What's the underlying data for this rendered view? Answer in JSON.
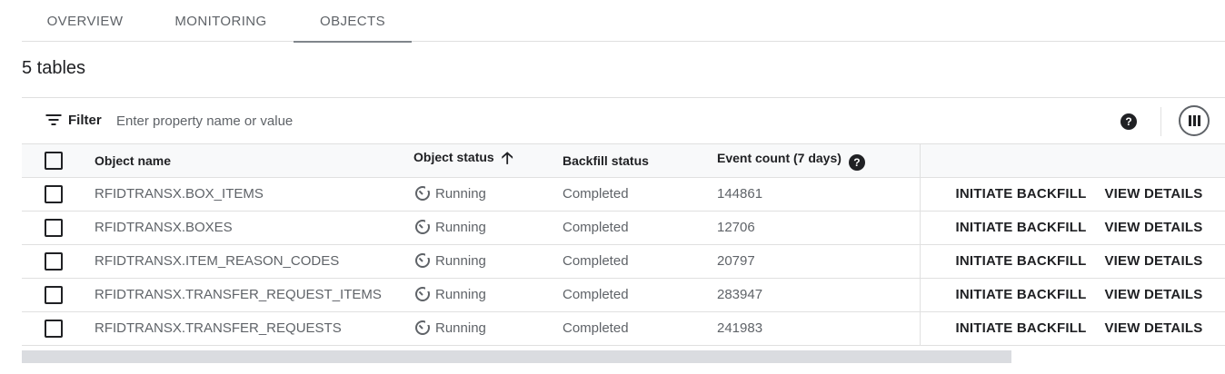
{
  "tabs": [
    "OVERVIEW",
    "MONITORING",
    "OBJECTS"
  ],
  "active_tab": "OBJECTS",
  "count_title": "5 tables",
  "filter": {
    "label": "Filter",
    "placeholder": "Enter property name or value"
  },
  "table": {
    "headers": {
      "name": "Object name",
      "status": "Object status",
      "backfill": "Backfill status",
      "event_count": "Event count (7 days)"
    },
    "sort": {
      "column": "Object status",
      "direction": "ascending"
    },
    "actions": {
      "initiate": "INITIATE BACKFILL",
      "view": "VIEW DETAILS"
    },
    "rows": [
      {
        "name": "RFIDTRANSX.BOX_ITEMS",
        "status": "Running",
        "backfill": "Completed",
        "event_count": "144861"
      },
      {
        "name": "RFIDTRANSX.BOXES",
        "status": "Running",
        "backfill": "Completed",
        "event_count": "12706"
      },
      {
        "name": "RFIDTRANSX.ITEM_REASON_CODES",
        "status": "Running",
        "backfill": "Completed",
        "event_count": "20797"
      },
      {
        "name": "RFIDTRANSX.TRANSFER_REQUEST_ITEMS",
        "status": "Running",
        "backfill": "Completed",
        "event_count": "283947"
      },
      {
        "name": "RFIDTRANSX.TRANSFER_REQUESTS",
        "status": "Running",
        "backfill": "Completed",
        "event_count": "241983"
      }
    ]
  },
  "icons": {
    "filter": "filter-list-icon",
    "help": "help-icon",
    "columns": "column-display-icon",
    "sort": "arrow-upward-icon",
    "status": "running-icon"
  }
}
